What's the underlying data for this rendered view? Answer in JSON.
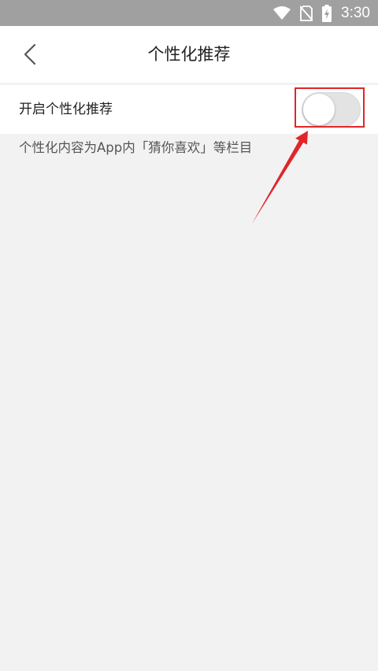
{
  "status_bar": {
    "time": "3:30",
    "icons": [
      "wifi-icon",
      "no-sim-icon",
      "battery-charging-icon"
    ]
  },
  "header": {
    "title": "个性化推荐",
    "back_icon": "chevron-left-icon"
  },
  "setting": {
    "label": "开启个性化推荐",
    "enabled": false
  },
  "description": "个性化内容为App内「猜你喜欢」等栏目",
  "colors": {
    "status_bar": "#a0a0a0",
    "background": "#f2f2f2",
    "annotation": "#e0262a",
    "toggle_off": "#e3e3e3"
  }
}
